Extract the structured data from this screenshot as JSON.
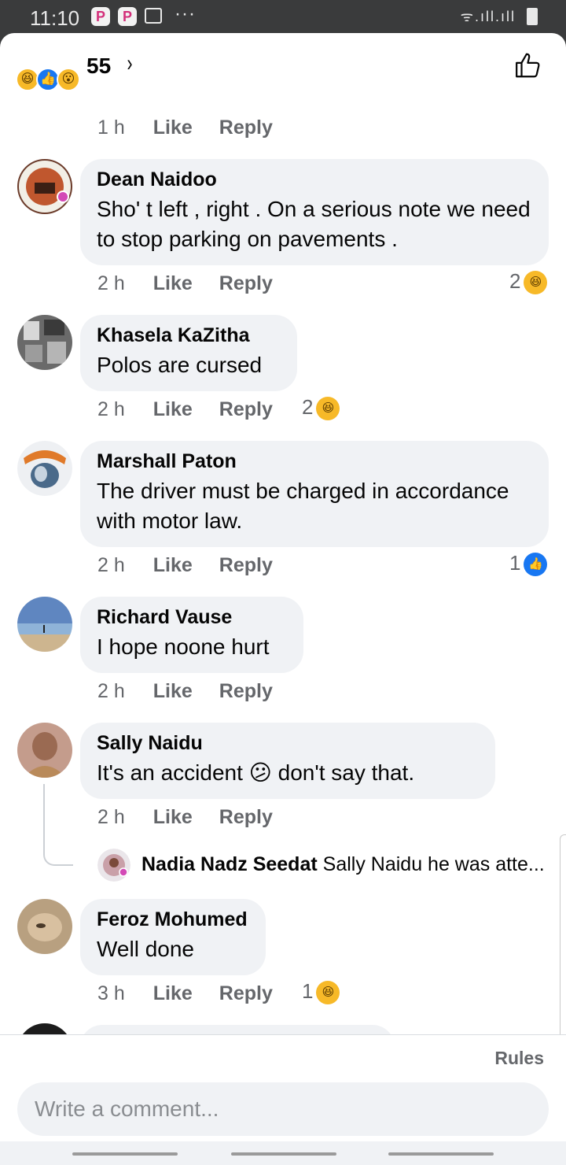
{
  "status_bar": {
    "time": "11:10",
    "apps": [
      "P",
      "P"
    ],
    "more": "···",
    "signal": "ᯤ.ıll.ıll"
  },
  "reactions_header": {
    "emojis": [
      {
        "icon": "haha-emoji-icon",
        "glyph": "😆"
      },
      {
        "icon": "like-emoji-icon",
        "glyph": "👍"
      },
      {
        "icon": "wow-emoji-icon",
        "glyph": "😮"
      }
    ],
    "count": "55",
    "chevron": "›",
    "like_icon": "thumbs-up-outline-icon"
  },
  "top_actions": {
    "time": "1 h",
    "like": "Like",
    "reply": "Reply"
  },
  "comments": [
    {
      "name": "Dean Naidoo",
      "text": "Sho' t  left ,  right . On a serious note we need to stop parking on pavements .",
      "time": "2 h",
      "like": "Like",
      "reply": "Reply",
      "reaction_count": "2",
      "reaction_type": "haha",
      "avatar_color": "#6b3b2a"
    },
    {
      "name": "Khasela KaZitha",
      "text": "Polos are cursed",
      "time": "2 h",
      "like": "Like",
      "reply": "Reply",
      "reaction_count": "2",
      "reaction_type": "haha",
      "avatar_color": "#5a5a5a"
    },
    {
      "name": "Marshall Paton",
      "text": "The driver must be charged in accordance with motor law.",
      "time": "2 h",
      "like": "Like",
      "reply": "Reply",
      "reaction_count": "1",
      "reaction_type": "like",
      "avatar_color": "#8aa0b8"
    },
    {
      "name": "Richard Vause",
      "text": "I hope noone hurt",
      "time": "2 h",
      "like": "Like",
      "reply": "Reply",
      "reaction_count": "",
      "reaction_type": "",
      "avatar_color": "#6f93c4"
    },
    {
      "name": "Sally Naidu",
      "text": "It's   an accident 😕  don't  say  that.",
      "time": "2 h",
      "like": "Like",
      "reply": "Reply",
      "reaction_count": "",
      "reaction_type": "",
      "avatar_color": "#b07a6a"
    },
    {
      "name": "Feroz Mohumed",
      "text": "Well done",
      "time": "3 h",
      "like": "Like",
      "reply": "Reply",
      "reaction_count": "1",
      "reaction_type": "haha",
      "avatar_color": "#a89070"
    }
  ],
  "reply_preview": {
    "name": "Nadia Nadz Seedat",
    "text": "Sally Naidu  he was atte...",
    "avatar_color": "#c9a0a8"
  },
  "footer": {
    "rules": "Rules",
    "placeholder": "Write a comment..."
  }
}
